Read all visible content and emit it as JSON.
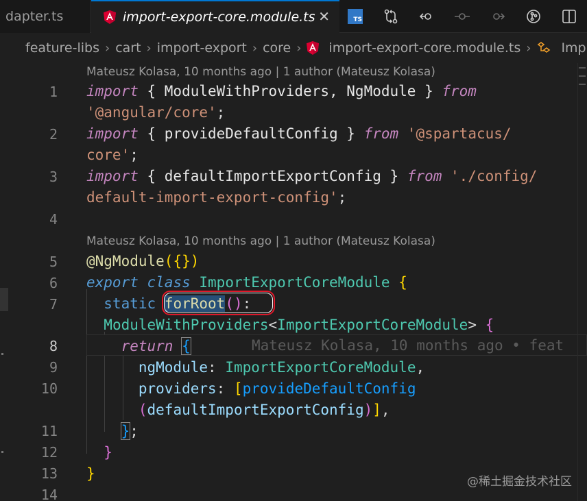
{
  "tabs": {
    "inactive_label": "dapter.ts",
    "active_label": "import-export-core.module.ts",
    "close_glyph": "✕",
    "ts_badge": "TS"
  },
  "actions": [
    {
      "name": "typescript-file-icon"
    },
    {
      "name": "git-compare-icon"
    },
    {
      "name": "go-back-icon"
    },
    {
      "name": "timeline-icon"
    },
    {
      "name": "go-forward-icon"
    },
    {
      "name": "git-graph-icon"
    },
    {
      "name": "split-editor-icon"
    }
  ],
  "breadcrumbs": {
    "items": [
      "feature-libs",
      "cart",
      "import-export",
      "core"
    ],
    "file": "import-export-core.module.ts",
    "symbol": "Imp"
  },
  "codelens": {
    "first": "Mateusz Kolasa, 10 months ago | 1 author (Mateusz Kolasa)",
    "second": "Mateusz Kolasa, 10 months ago | 1 author (Mateusz Kolasa)"
  },
  "line_numbers": [
    "1",
    "2",
    "3",
    "4",
    "5",
    "6",
    "7",
    "8",
    "9",
    "10",
    "11",
    "12",
    "13",
    "14"
  ],
  "code": {
    "l1a_kw": "import",
    "l1a_mid": " { ModuleWithProviders, NgModule } ",
    "l1a_from": "from",
    "l1b_str": "'@angular/core'",
    "l1b_end": ";",
    "l2a_kw": "import",
    "l2a_mid": " { provideDefaultConfig } ",
    "l2a_from": "from",
    "l2a_str": " '@spartacus/",
    "l2b_str": "core'",
    "l2b_end": ";",
    "l3a_kw": "import",
    "l3a_mid": " { defaultImportExportConfig } ",
    "l3a_from": "from",
    "l3a_str": " './config/",
    "l3b_str": "default-import-export-config'",
    "l3b_end": ";",
    "l5_deco": "@NgModule",
    "l5_args": "({})",
    "l6_export": "export",
    "l6_class": "class",
    "l6_name": "ImportExportCoreModule",
    "l6_brace": "{",
    "l7a_static": "static",
    "l7a_fn": "forRoot",
    "l7a_parens": "()",
    "l7a_colon": ":",
    "l7b_type": "ModuleWithProviders",
    "l7b_lt": "<",
    "l7b_gen": "ImportExportCoreModule",
    "l7b_gt": ">",
    "l7b_brace": "{",
    "l8_return": "return",
    "l8_brace": "{",
    "l8_blame": "Mateusz Kolasa, 10 months ago • feat",
    "l9_prop": "ngModule",
    "l9_val": "ImportExportCoreModule",
    "l9_end": ",",
    "l10a_prop": "providers",
    "l10a_bracket": "[",
    "l10a_fn": "provideDefaultConfig",
    "l10b_open": "(",
    "l10b_arg": "defaultImportExportConfig",
    "l10b_close": ")",
    "l10b_bracket": "]",
    "l10b_end": ",",
    "l11_brace": "}",
    "l11_end": ";",
    "l12_brace": "}",
    "l13_brace": "}"
  },
  "watermark": "@稀土掘金技术社区"
}
